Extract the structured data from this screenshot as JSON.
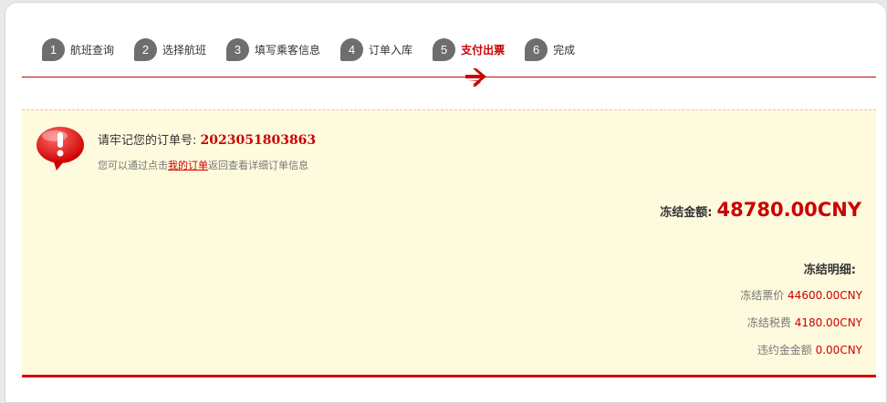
{
  "steps": [
    {
      "num": "1",
      "label": "航班查询",
      "active": false
    },
    {
      "num": "2",
      "label": "选择航班",
      "active": false
    },
    {
      "num": "3",
      "label": "填写乘客信息",
      "active": false
    },
    {
      "num": "4",
      "label": "订单入库",
      "active": false
    },
    {
      "num": "5",
      "label": "支付出票",
      "active": true
    },
    {
      "num": "6",
      "label": "完成",
      "active": false
    }
  ],
  "notice": {
    "order_prefix": "请牢记您的订单号:",
    "order_number": "2023051803863",
    "hint_before": "您可以通过点击",
    "hint_link": "我的订单",
    "hint_after": "返回查看详细订单信息"
  },
  "frozen": {
    "total_label": "冻结金额:",
    "total_amount": "48780.00CNY",
    "detail_title": "冻结明细:",
    "rows": [
      {
        "label": "冻结票价",
        "value": "44600.00CNY"
      },
      {
        "label": "冻结税费",
        "value": "4180.00CNY"
      },
      {
        "label": "违约金金额",
        "value": "0.00CNY"
      }
    ]
  },
  "colors": {
    "accent": "#cc0000",
    "notice_bg": "#fefadd",
    "step_circle": "#6e6e6e"
  },
  "icons": [
    "plane-icon",
    "alert-icon"
  ]
}
